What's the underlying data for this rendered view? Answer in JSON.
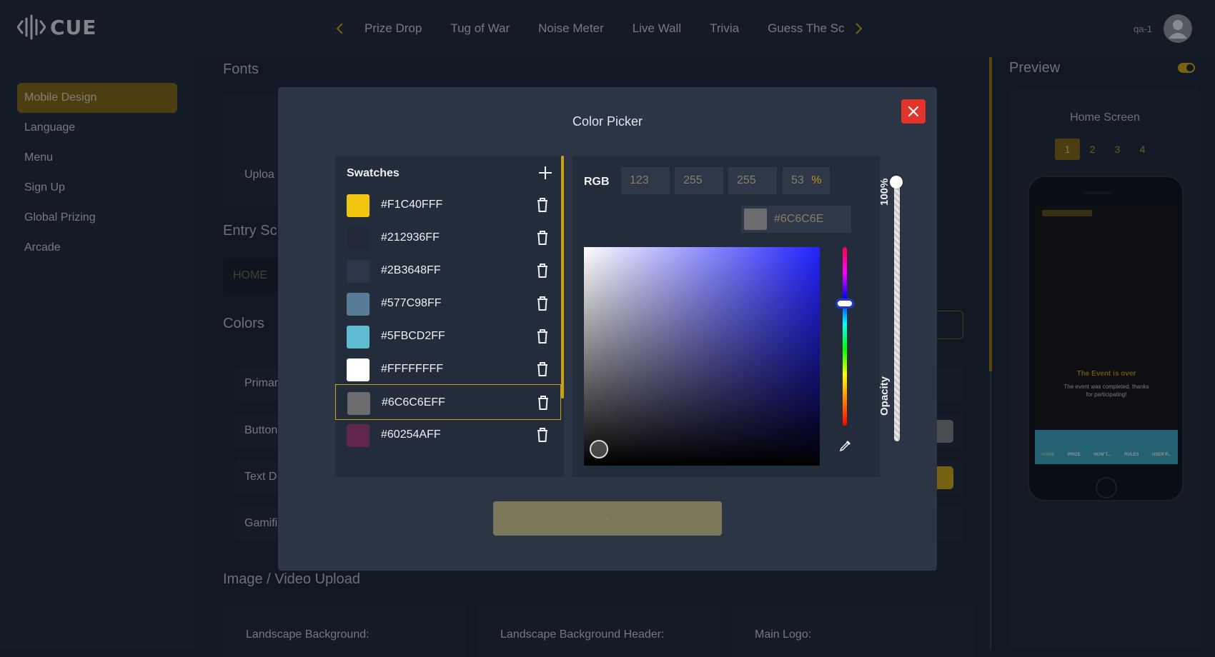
{
  "app": {
    "logo_text": "CUE"
  },
  "nav": {
    "items": [
      "Prize Drop",
      "Tug of War",
      "Noise Meter",
      "Live Wall",
      "Trivia",
      "Guess The Sc"
    ]
  },
  "user": {
    "name": "qa-1"
  },
  "sidebar": {
    "items": [
      {
        "label": "Mobile Design",
        "active": true
      },
      {
        "label": "Language"
      },
      {
        "label": "Menu"
      },
      {
        "label": "Sign Up"
      },
      {
        "label": "Global Prizing"
      },
      {
        "label": "Arcade"
      }
    ]
  },
  "main": {
    "fonts_title": "Fonts",
    "upload_label": "Uploa",
    "entry_title": "Entry Sc",
    "home_tab": "HOME",
    "colors_title": "Colors",
    "color_rows": [
      "Primar",
      "Button",
      "Text D",
      "Gamifi"
    ],
    "image_title": "Image / Video Upload",
    "uploads": [
      "Landscape Background:",
      "Landscape Background Header:",
      "Main Logo:"
    ]
  },
  "preview": {
    "title": "Preview",
    "screen_label": "Home Screen",
    "pages": [
      "1",
      "2",
      "3",
      "4"
    ],
    "event_title": "The Event is over",
    "event_sub": "The event was completed, thanks for participating!",
    "phone_nav": [
      "HOME",
      "PRIZE",
      "HOW T...",
      "RULES",
      "USER P..."
    ]
  },
  "color_picker": {
    "title": "Color Picker",
    "swatches_label": "Swatches",
    "swatches": [
      {
        "hex": "#F1C40FFF",
        "color": "#F1C40F"
      },
      {
        "hex": "#212936FF",
        "color": "#212936"
      },
      {
        "hex": "#2B3648FF",
        "color": "#2B3648"
      },
      {
        "hex": "#577C98FF",
        "color": "#577C98"
      },
      {
        "hex": "#5FBCD2FF",
        "color": "#5FBCD2"
      },
      {
        "hex": "#FFFFFFFF",
        "color": "#FFFFFF"
      },
      {
        "hex": "#6C6C6EFF",
        "color": "#6C6C6E",
        "selected": true
      },
      {
        "hex": "#60254AFF",
        "color": "#60254A"
      }
    ],
    "mode_label": "RGB",
    "r": "123",
    "g": "255",
    "b": "255",
    "alpha": "53",
    "alpha_unit": "%",
    "hex_value": "#6C6C6E",
    "opacity_value": "100%",
    "opacity_label": "Opacity",
    "confirm_label": "."
  },
  "colors": {
    "accent": "#C9A114",
    "close": "#E4332B",
    "modal_bg": "#2B3546",
    "panel_bg": "#232C3A"
  }
}
